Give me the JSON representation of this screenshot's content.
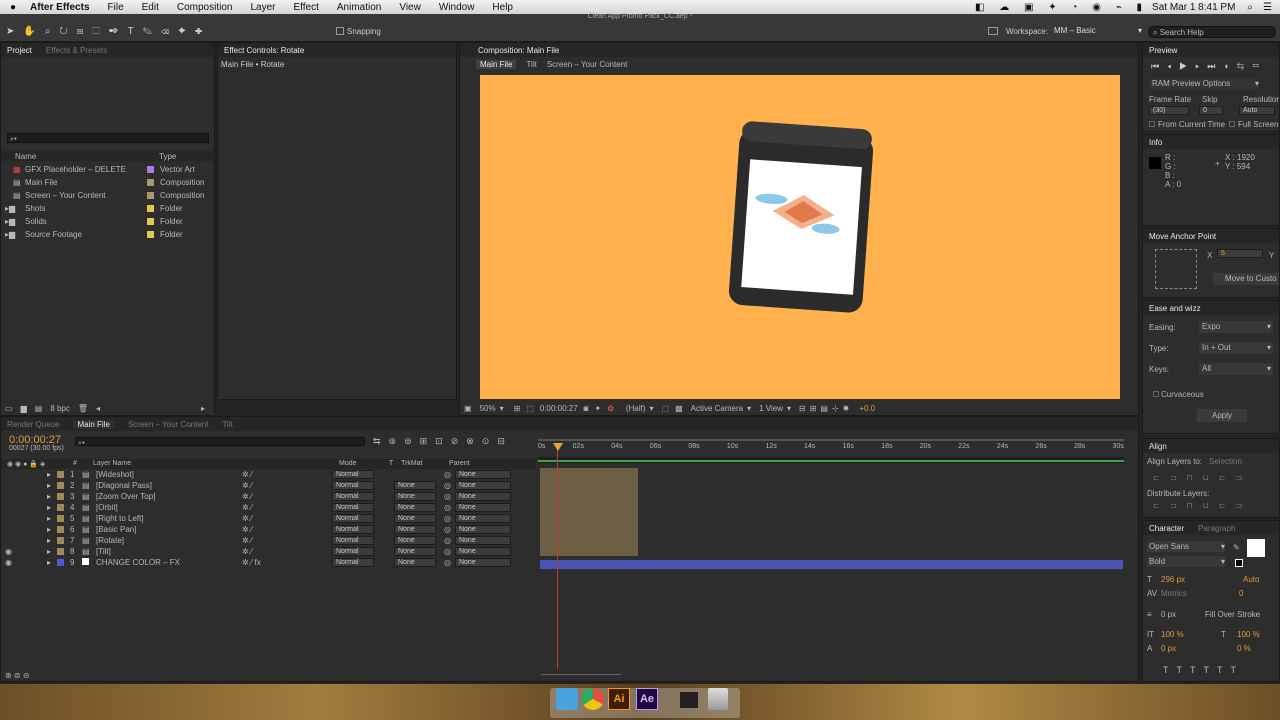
{
  "menubar": {
    "apple": "",
    "app_name": "After Effects",
    "items": [
      "File",
      "Edit",
      "Composition",
      "Layer",
      "Effect",
      "Animation",
      "View",
      "Window",
      "Help"
    ],
    "clock": "Sat Mar 1  8:41 PM"
  },
  "window_title": "Clean App Promo Pack_CC.aep *",
  "toolbar": {
    "snapping_label": "Snapping",
    "workspace_label": "Workspace:",
    "workspace_value": "MM – Basic",
    "search_placeholder": "Search Help"
  },
  "project_panel": {
    "tabs": [
      "Project",
      "Effects & Presets"
    ],
    "columns": {
      "name": "Name",
      "type": "Type"
    },
    "items": [
      {
        "name": "GFX Placeholder – DELETE",
        "type": "Vector Art",
        "color": "#b07ad8"
      },
      {
        "name": "Main File",
        "type": "Composition",
        "color": "#a89a6a"
      },
      {
        "name": "Screen – Your Content",
        "type": "Composition",
        "color": "#a89a6a"
      },
      {
        "name": "Shots",
        "type": "Folder",
        "color": "#e3c84a"
      },
      {
        "name": "Solids",
        "type": "Folder",
        "color": "#e3c84a"
      },
      {
        "name": "Source Footage",
        "type": "Folder",
        "color": "#e3c84a"
      }
    ],
    "bpc": "8 bpc"
  },
  "effect_controls": {
    "tab": "Effect Controls: Rotate",
    "breadcrumb": "Main File • Rotate"
  },
  "composition": {
    "tab": "Composition: Main File",
    "crumbs": [
      "Main File",
      "Tilt",
      "Screen – Your Content"
    ],
    "bg_color": "#ffb14d",
    "zoom": "50%",
    "timecode": "0:00:00:27",
    "resolution": "(Half)",
    "camera": "Active Camera",
    "views": "1 View",
    "exposure": "+0.0"
  },
  "preview": {
    "tab": "Preview",
    "ram_options": "RAM Preview Options",
    "frame_rate_label": "Frame Rate",
    "skip_label": "Skip",
    "resolution_label": "Resolution",
    "frame_rate": "(30)",
    "skip": "0",
    "resolution": "Auto",
    "from_current": "From Current Time",
    "full_screen": "Full Screen"
  },
  "info": {
    "tab": "Info",
    "r": "R :",
    "g": "G :",
    "b": "B :",
    "a": "A : 0",
    "x": "X : 1920",
    "y": "Y : 594"
  },
  "anchor": {
    "tab": "Move Anchor Point",
    "x_label": "X",
    "x_value": "5",
    "y_label": "Y",
    "button": "Move to Custo"
  },
  "ease": {
    "tab": "Ease and wizz",
    "easing_label": "Easing:",
    "easing": "Expo",
    "type_label": "Type:",
    "type": "In + Out",
    "keys_label": "Keys:",
    "keys": "All",
    "curvaceous": "Curvaceous",
    "apply": "Apply"
  },
  "align": {
    "tab": "Align",
    "align_to_label": "Align Layers to:",
    "align_to": "Selection",
    "distribute": "Distribute Layers:"
  },
  "character": {
    "tabs": [
      "Character",
      "Paragraph"
    ],
    "font": "Open Sans",
    "style": "Bold",
    "size": "296 px",
    "leading": "Auto",
    "kerning": "Metrics",
    "tracking": "0",
    "stroke": "0 px",
    "stroke_type": "Fill Over Stroke",
    "vscale": "100 %",
    "hscale": "100 %",
    "baseline": "0 px",
    "tsume": "0 %"
  },
  "timeline": {
    "tabs": [
      "Render Queue",
      "Main File",
      "Screen – Your Content",
      "Tilt"
    ],
    "timecode": "0:00:00:27",
    "frames": "00027 (30.00 fps)",
    "columns": {
      "num": "#",
      "name": "Layer Name",
      "mode": "Mode",
      "t": "T",
      "trkmat": "TrkMat",
      "parent": "Parent"
    },
    "ruler": [
      "0s",
      "02s",
      "04s",
      "06s",
      "08s",
      "10s",
      "12s",
      "14s",
      "16s",
      "18s",
      "20s",
      "22s",
      "24s",
      "26s",
      "28s",
      "30s"
    ],
    "layers": [
      {
        "num": "1",
        "name": "[Wideshot]",
        "mode": "Normal",
        "trkmat": "",
        "parent": "None"
      },
      {
        "num": "2",
        "name": "[Diagonal Pass]",
        "mode": "Normal",
        "trkmat": "None",
        "parent": "None"
      },
      {
        "num": "3",
        "name": "[Zoom Over Top]",
        "mode": "Normal",
        "trkmat": "None",
        "parent": "None"
      },
      {
        "num": "4",
        "name": "[Orbit]",
        "mode": "Normal",
        "trkmat": "None",
        "parent": "None"
      },
      {
        "num": "5",
        "name": "[Right to Left]",
        "mode": "Normal",
        "trkmat": "None",
        "parent": "None"
      },
      {
        "num": "6",
        "name": "[Basic Pan]",
        "mode": "Normal",
        "trkmat": "None",
        "parent": "None"
      },
      {
        "num": "7",
        "name": "[Rotate]",
        "mode": "Normal",
        "trkmat": "None",
        "parent": "None"
      },
      {
        "num": "8",
        "name": "[Tilt]",
        "mode": "Normal",
        "trkmat": "None",
        "parent": "None"
      },
      {
        "num": "9",
        "name": "CHANGE COLOR – FX",
        "mode": "Normal",
        "trkmat": "None",
        "parent": "None"
      }
    ]
  },
  "dock": {
    "apps": [
      "Finder",
      "Chrome",
      "Illustrator",
      "After Effects",
      "Trash"
    ],
    "ai": "Ai",
    "ae": "Ae"
  }
}
